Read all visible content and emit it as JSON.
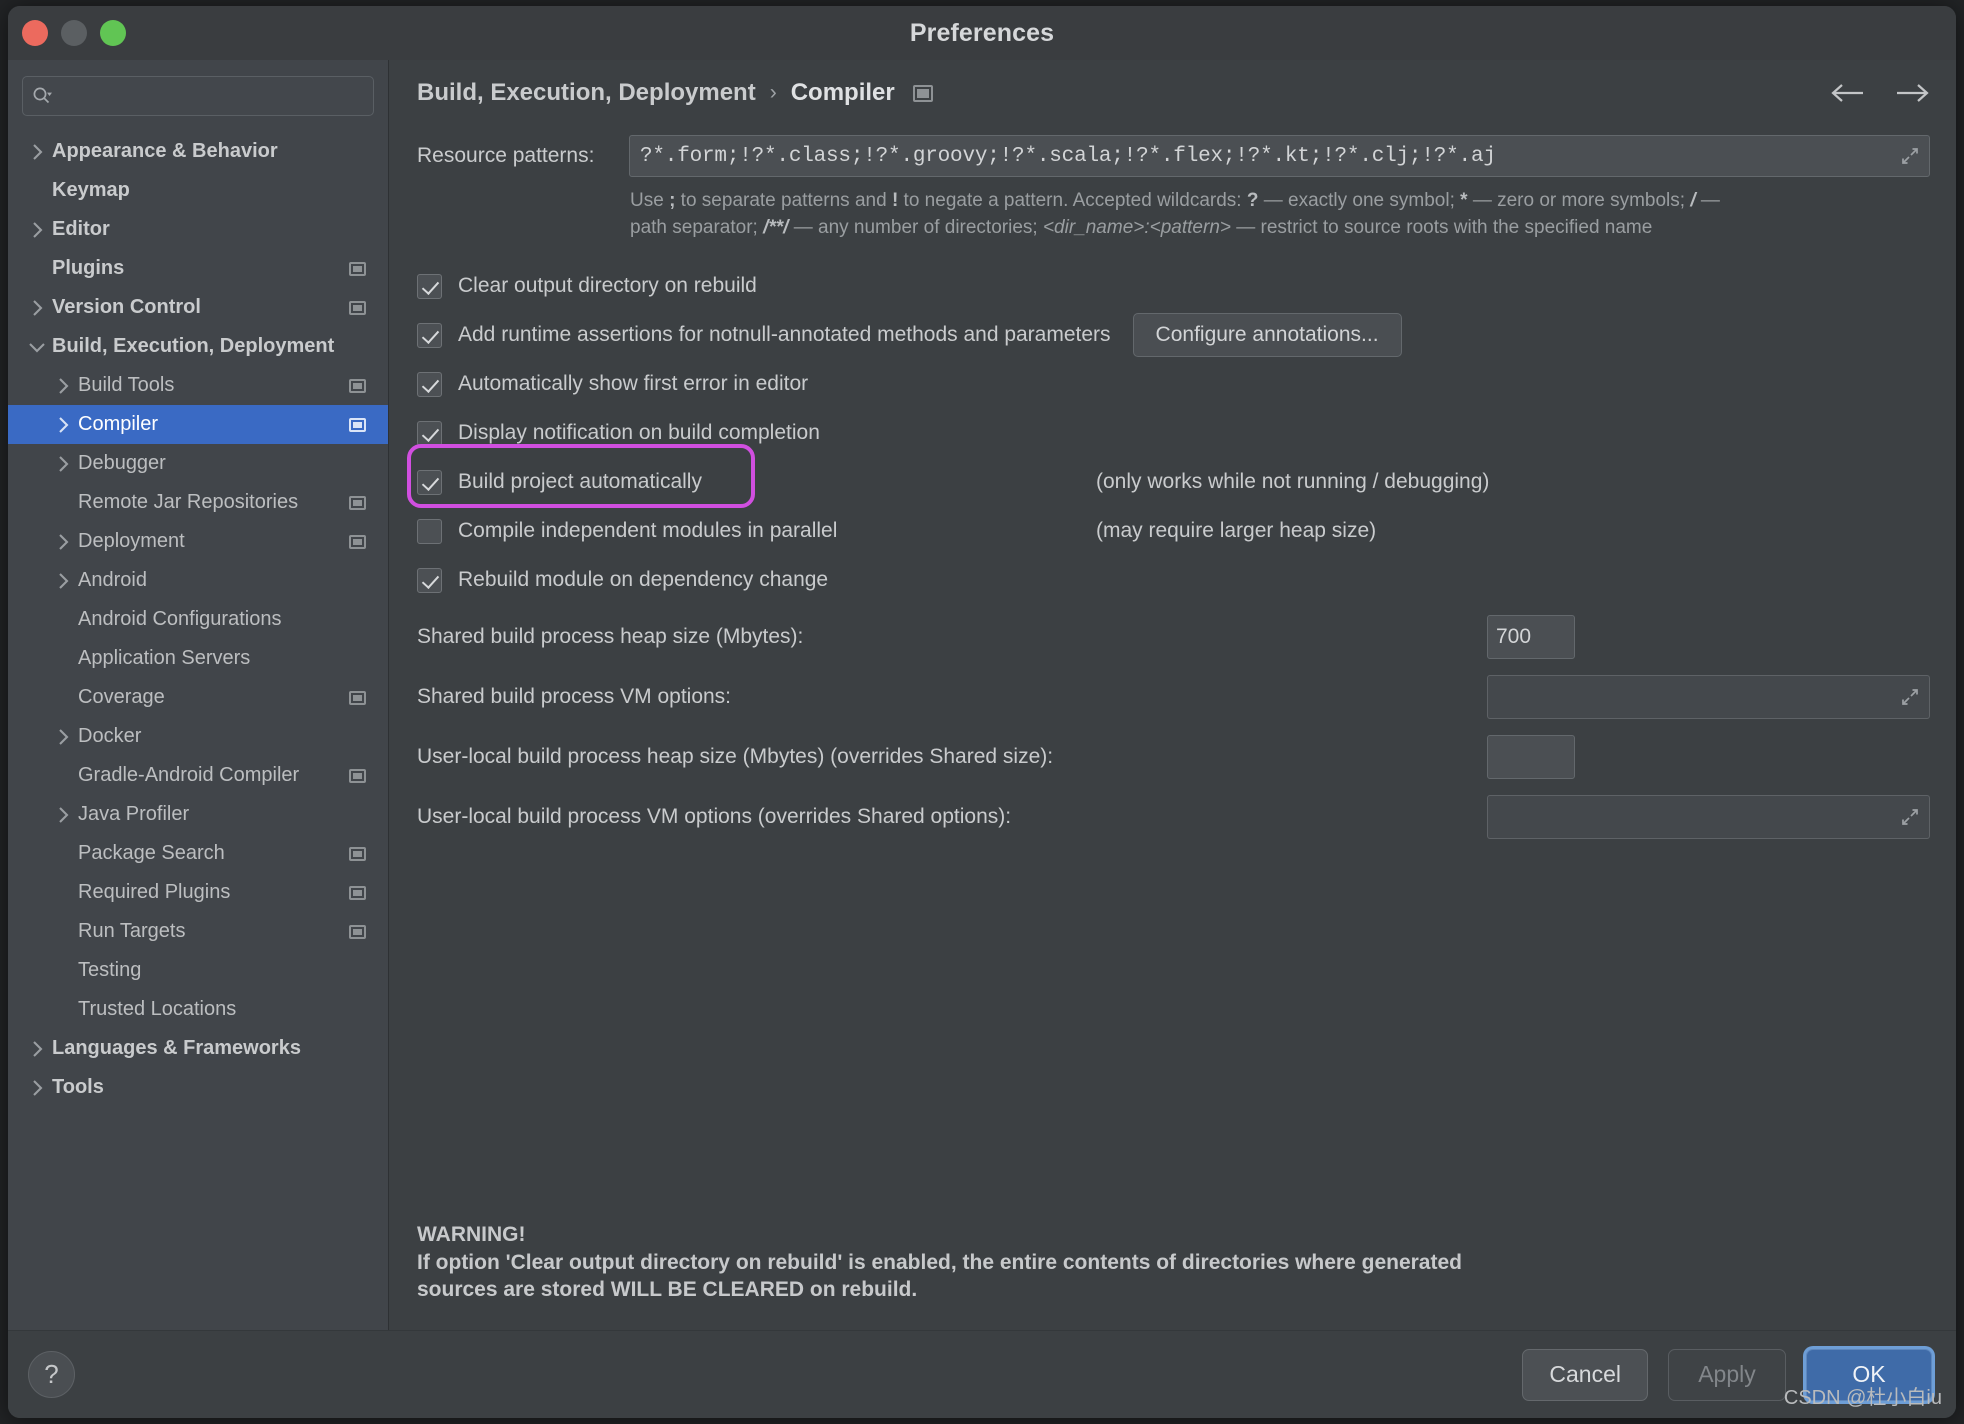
{
  "window": {
    "title": "Preferences",
    "traffic_lights": [
      "close-button",
      "minimize-button",
      "zoom-button"
    ]
  },
  "search": {
    "value": "",
    "placeholder": ""
  },
  "sidebar": {
    "items": [
      {
        "label": "Appearance & Behavior",
        "level": 0,
        "arrow": "right",
        "badge": false,
        "selected": false
      },
      {
        "label": "Keymap",
        "level": 0,
        "arrow": "none",
        "badge": false,
        "selected": false
      },
      {
        "label": "Editor",
        "level": 0,
        "arrow": "right",
        "badge": false,
        "selected": false
      },
      {
        "label": "Plugins",
        "level": 0,
        "arrow": "none",
        "badge": true,
        "selected": false
      },
      {
        "label": "Version Control",
        "level": 0,
        "arrow": "right",
        "badge": true,
        "selected": false
      },
      {
        "label": "Build, Execution, Deployment",
        "level": 0,
        "arrow": "down",
        "badge": false,
        "selected": false
      },
      {
        "label": "Build Tools",
        "level": 1,
        "arrow": "right",
        "badge": true,
        "selected": false
      },
      {
        "label": "Compiler",
        "level": 1,
        "arrow": "right",
        "badge": true,
        "selected": true
      },
      {
        "label": "Debugger",
        "level": 1,
        "arrow": "right",
        "badge": false,
        "selected": false
      },
      {
        "label": "Remote Jar Repositories",
        "level": 1,
        "arrow": "none",
        "badge": true,
        "selected": false
      },
      {
        "label": "Deployment",
        "level": 1,
        "arrow": "right",
        "badge": true,
        "selected": false
      },
      {
        "label": "Android",
        "level": 1,
        "arrow": "right",
        "badge": false,
        "selected": false
      },
      {
        "label": "Android Configurations",
        "level": 1,
        "arrow": "none",
        "badge": false,
        "selected": false
      },
      {
        "label": "Application Servers",
        "level": 1,
        "arrow": "none",
        "badge": false,
        "selected": false
      },
      {
        "label": "Coverage",
        "level": 1,
        "arrow": "none",
        "badge": true,
        "selected": false
      },
      {
        "label": "Docker",
        "level": 1,
        "arrow": "right",
        "badge": false,
        "selected": false
      },
      {
        "label": "Gradle-Android Compiler",
        "level": 1,
        "arrow": "none",
        "badge": true,
        "selected": false
      },
      {
        "label": "Java Profiler",
        "level": 1,
        "arrow": "right",
        "badge": false,
        "selected": false
      },
      {
        "label": "Package Search",
        "level": 1,
        "arrow": "none",
        "badge": true,
        "selected": false
      },
      {
        "label": "Required Plugins",
        "level": 1,
        "arrow": "none",
        "badge": true,
        "selected": false
      },
      {
        "label": "Run Targets",
        "level": 1,
        "arrow": "none",
        "badge": true,
        "selected": false
      },
      {
        "label": "Testing",
        "level": 1,
        "arrow": "none",
        "badge": false,
        "selected": false
      },
      {
        "label": "Trusted Locations",
        "level": 1,
        "arrow": "none",
        "badge": false,
        "selected": false
      },
      {
        "label": "Languages & Frameworks",
        "level": 0,
        "arrow": "right",
        "badge": false,
        "selected": false
      },
      {
        "label": "Tools",
        "level": 0,
        "arrow": "right",
        "badge": false,
        "selected": false
      }
    ]
  },
  "breadcrumb": {
    "parent": "Build, Execution, Deployment",
    "separator": "›",
    "current": "Compiler"
  },
  "resource_patterns": {
    "label": "Resource patterns:",
    "value": "?*.form;!?*.class;!?*.groovy;!?*.scala;!?*.flex;!?*.kt;!?*.clj;!?*.aj",
    "hint_line1_a": "Use ",
    "hint_semicolon": ";",
    "hint_line1_b": " to separate patterns and ",
    "hint_bang": "!",
    "hint_line1_c": " to negate a pattern. Accepted wildcards: ",
    "hint_q": "?",
    "hint_line1_d": " — exactly one symbol; ",
    "hint_star": "*",
    "hint_line1_e": " — zero or more symbols; ",
    "hint_slash": "/",
    "hint_line2_a": " — path separator; ",
    "hint_globstar": "/**/",
    "hint_line2_b": " — any number of directories; ",
    "hint_dirpattern": "<dir_name>:<pattern>",
    "hint_line2_c": " — restrict to source roots with the specified name"
  },
  "checkboxes": [
    {
      "label": "Clear output directory on rebuild",
      "checked": true,
      "note": "",
      "button": ""
    },
    {
      "label": "Add runtime assertions for notnull-annotated methods and parameters",
      "checked": true,
      "note": "",
      "button": "Configure annotations..."
    },
    {
      "label": "Automatically show first error in editor",
      "checked": true,
      "note": "",
      "button": ""
    },
    {
      "label": "Display notification on build completion",
      "checked": true,
      "note": "",
      "button": ""
    },
    {
      "label": "Build project automatically",
      "checked": true,
      "note": "(only works while not running / debugging)",
      "button": ""
    },
    {
      "label": "Compile independent modules in parallel",
      "checked": false,
      "note": "(may require larger heap size)",
      "button": ""
    },
    {
      "label": "Rebuild module on dependency change",
      "checked": true,
      "note": "",
      "button": ""
    }
  ],
  "annotation": {
    "color": "#d14fe0",
    "target": "Build project automatically"
  },
  "fields": [
    {
      "label": "Shared build process heap size (Mbytes):",
      "value": "700",
      "kind": "small"
    },
    {
      "label": "Shared build process VM options:",
      "value": "",
      "kind": "wide"
    },
    {
      "label": "User-local build process heap size (Mbytes) (overrides Shared size):",
      "value": "",
      "kind": "small"
    },
    {
      "label": "User-local build process VM options (overrides Shared options):",
      "value": "",
      "kind": "wide"
    }
  ],
  "warning": {
    "title": "WARNING!",
    "line1": "If option 'Clear output directory on rebuild' is enabled, the entire contents of directories where generated",
    "line2": "sources are stored WILL BE CLEARED on rebuild."
  },
  "footer": {
    "help": "?",
    "cancel": "Cancel",
    "apply": "Apply",
    "ok": "OK"
  },
  "watermark": "CSDN @杜小白iu"
}
